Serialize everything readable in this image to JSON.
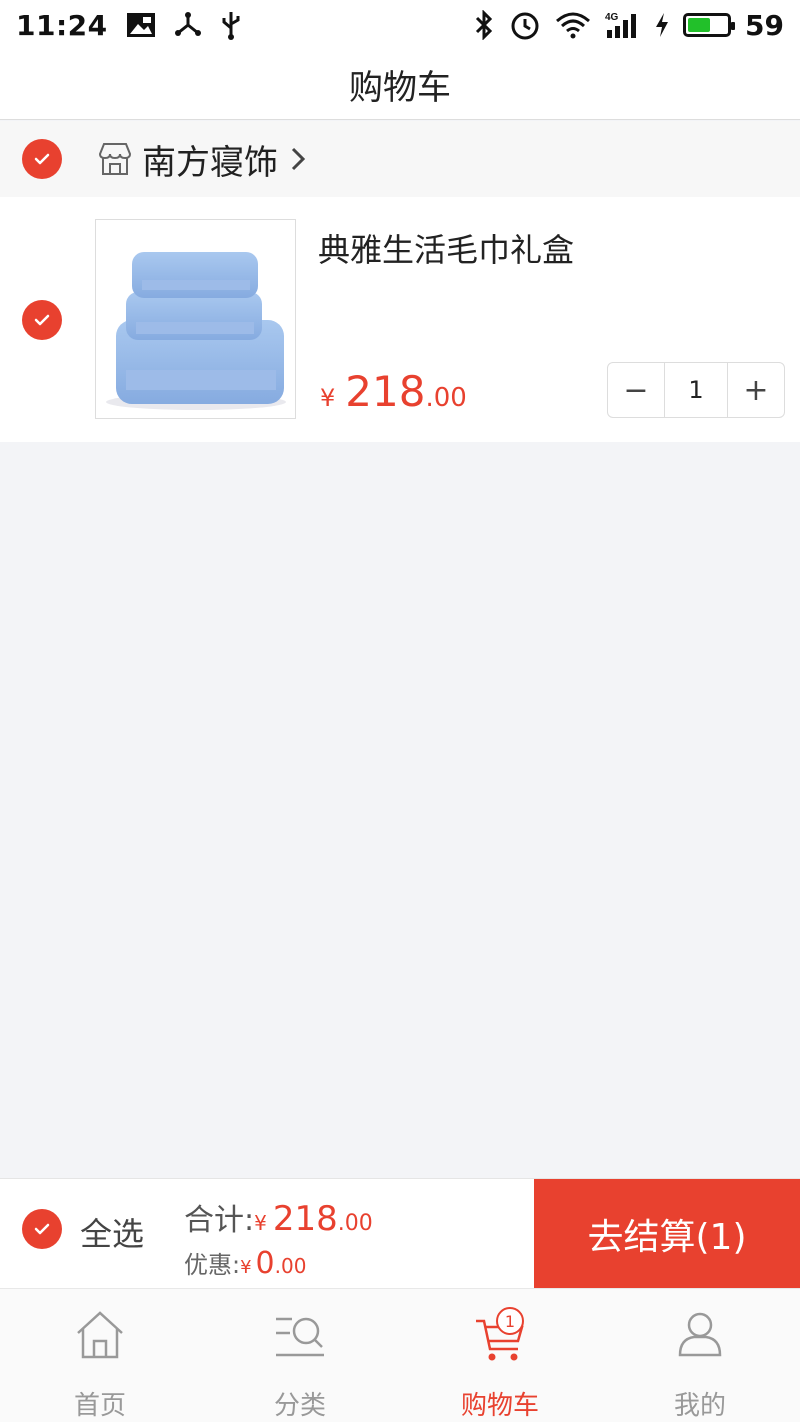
{
  "status_bar": {
    "time": "11:24",
    "battery_level": "59",
    "network": "4G",
    "battery_fill": 0.59
  },
  "header": {
    "title": "购物车"
  },
  "shop": {
    "name": "南方寝饰"
  },
  "items": [
    {
      "title": "典雅生活毛巾礼盒",
      "price_symbol": "¥",
      "price_int": "218",
      "price_dec": ".00",
      "quantity": "1",
      "minus": "−",
      "plus": "+"
    }
  ],
  "summary": {
    "select_all_label": "全选",
    "total_label": "合计:",
    "total_symbol": "¥",
    "total_int": "218",
    "total_dec": ".00",
    "discount_label": "优惠:",
    "discount_symbol": "¥",
    "discount_int": "0",
    "discount_dec": ".00",
    "checkout_label": "去结算(1)"
  },
  "tabs": [
    {
      "label": "首页",
      "icon": "home-icon"
    },
    {
      "label": "分类",
      "icon": "category-search-icon"
    },
    {
      "label": "购物车",
      "icon": "cart-icon",
      "badge": "1",
      "active": true
    },
    {
      "label": "我的",
      "icon": "user-icon"
    }
  ],
  "colors": {
    "accent": "#e8412f",
    "background": "#f3f4f7"
  }
}
